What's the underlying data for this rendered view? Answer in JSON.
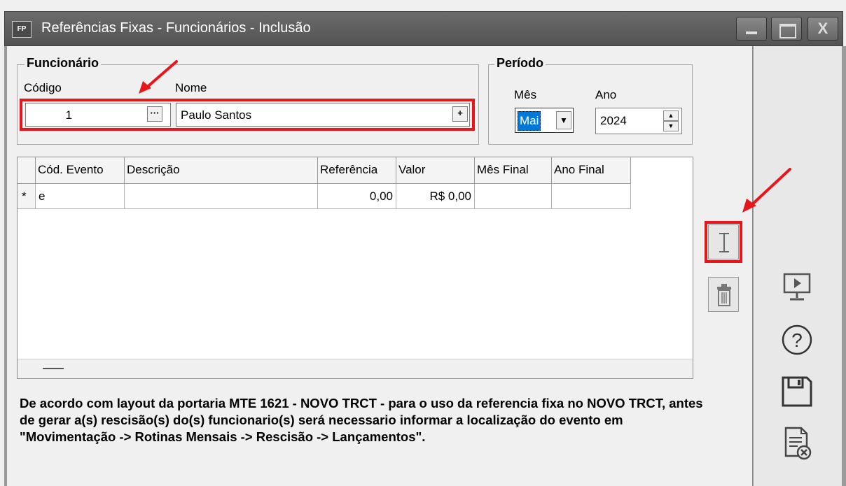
{
  "window": {
    "app_badge": "FP",
    "title": "Referências Fixas - Funcionários - Inclusão",
    "close_glyph": "X"
  },
  "funcionario": {
    "legend": "Funcionário",
    "codigo_label": "Código",
    "nome_label": "Nome",
    "codigo_value": "1",
    "nome_value": "Paulo Santos",
    "lookup_btn": "···",
    "add_btn": "+"
  },
  "periodo": {
    "legend": "Período",
    "mes_label": "Mês",
    "ano_label": "Ano",
    "mes_value": "Mai",
    "ano_value": "2024"
  },
  "grid": {
    "columns": [
      "",
      "Cód. Evento",
      "Descrição",
      "Referência",
      "Valor",
      "Mês Final",
      "Ano Final"
    ],
    "rows": [
      [
        "*",
        "e",
        "",
        "0,00",
        "R$ 0,00",
        "",
        ""
      ]
    ]
  },
  "notice": "De acordo com layout da portaria MTE 1621 - NOVO TRCT - para o uso da referencia fixa no NOVO TRCT, antes de gerar a(s) rescisão(s) do(s) funcionario(s) será necessario informar a localização do evento em \"Movimentação -> Rotinas Mensais -> Rescisão -> Lançamentos\".",
  "icons": [
    "insert-icon",
    "trash-icon",
    "monitor-play-icon",
    "help-icon",
    "save-icon",
    "cancel-document-icon"
  ],
  "colors": {
    "highlight": "#e8151b",
    "titlebar": "#5d5d5d",
    "selection": "#0078d7"
  }
}
